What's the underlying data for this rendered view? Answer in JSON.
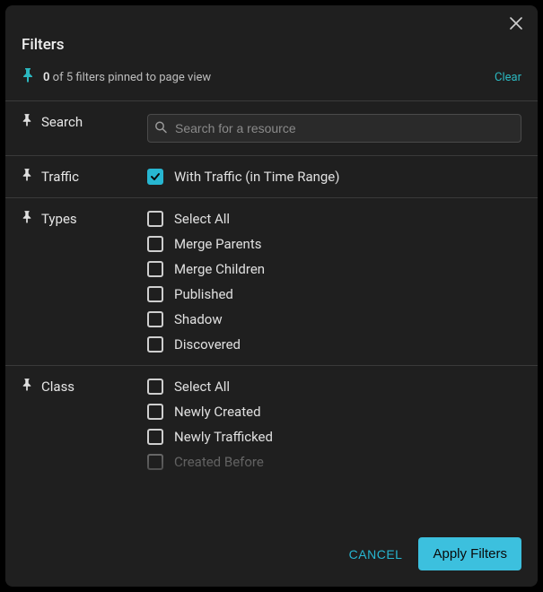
{
  "title": "Filters",
  "pin_status": {
    "count": "0",
    "middle": " of 5",
    "rest": " filters pinned to page view"
  },
  "clear_label": "Clear",
  "search": {
    "label": "Search",
    "placeholder": "Search for a resource",
    "value": ""
  },
  "traffic": {
    "label": "Traffic",
    "option_label": "With Traffic (in Time Range)",
    "checked": true
  },
  "types": {
    "label": "Types",
    "items": [
      {
        "label": "Select All",
        "checked": false
      },
      {
        "label": "Merge Parents",
        "checked": false
      },
      {
        "label": "Merge Children",
        "checked": false
      },
      {
        "label": "Published",
        "checked": false
      },
      {
        "label": "Shadow",
        "checked": false
      },
      {
        "label": "Discovered",
        "checked": false
      }
    ]
  },
  "class": {
    "label": "Class",
    "items": [
      {
        "label": "Select All",
        "checked": false
      },
      {
        "label": "Newly Created",
        "checked": false
      },
      {
        "label": "Newly Trafficked",
        "checked": false
      },
      {
        "label": "Created Before",
        "checked": false
      }
    ]
  },
  "footer": {
    "cancel": "CANCEL",
    "apply": "Apply Filters"
  }
}
